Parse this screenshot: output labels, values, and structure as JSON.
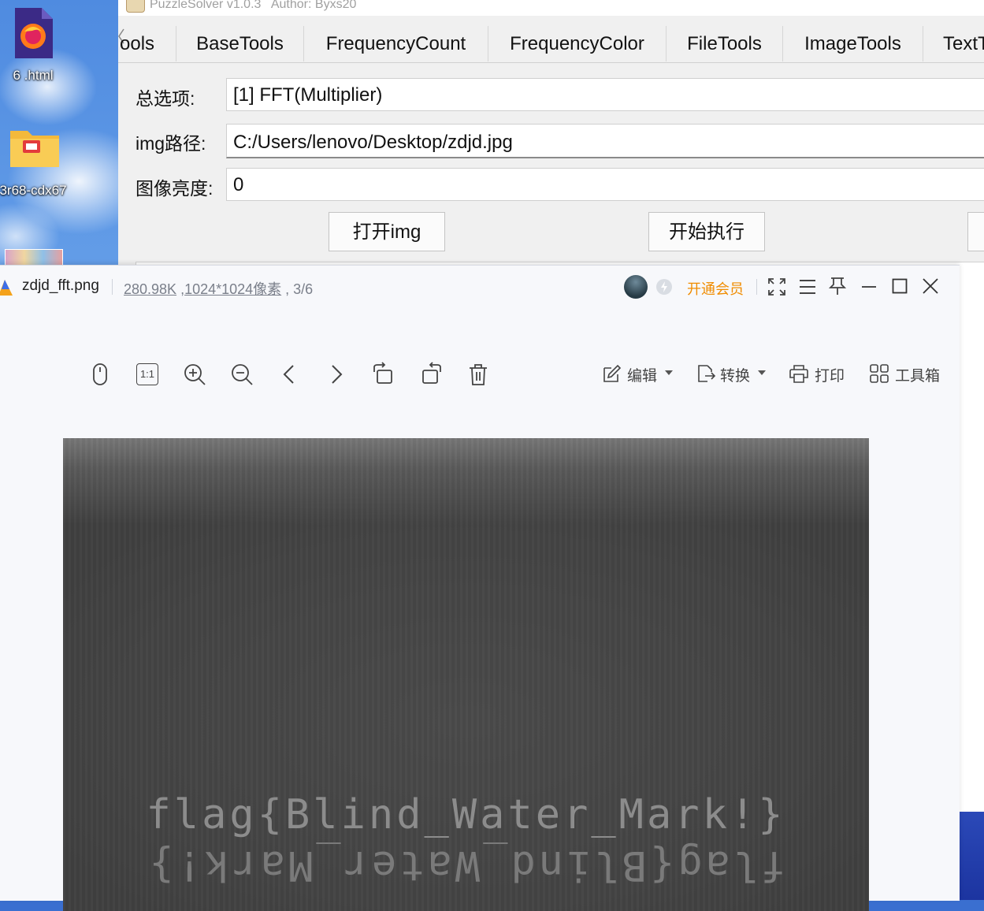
{
  "desktop": {
    "icons": [
      {
        "label": "6 .html",
        "icon": "firefox-html-file-icon"
      },
      {
        "label": "3r68-cdx67",
        "icon": "folder-icon"
      }
    ]
  },
  "puzzle_solver": {
    "title": "PuzzleSolver v1.0.3   Author: Byxs20",
    "tabs": [
      "ools",
      "BaseTools",
      "FrequencyCount",
      "FrequencyColor",
      "FileTools",
      "ImageTools",
      "TextT"
    ],
    "fields": [
      {
        "label": "总选项:",
        "value": "[1] FFT(Multiplier)"
      },
      {
        "label": "img路径:",
        "value": "C:/Users/lenovo/Desktop/zdjd.jpg"
      },
      {
        "label": "图像亮度:",
        "value": "0"
      }
    ],
    "buttons": {
      "open": "打开img",
      "run": "开始执行"
    }
  },
  "viewer": {
    "filename": "zdjd_fft.png",
    "info": {
      "size": "280.98K",
      "separator": " ,",
      "dims": "1024*1024像素",
      "index": " , 3/6"
    },
    "vip_label": "开通会员",
    "accent_color": "#f08c00",
    "toolbar": {
      "icons": [
        "mouse-icon",
        "actual-size-icon",
        "zoom-in-icon",
        "zoom-out-icon",
        "previous-icon",
        "next-icon",
        "rotate-left-icon",
        "rotate-right-icon",
        "delete-icon"
      ],
      "actual_size_label": "1:1",
      "edit": "编辑",
      "convert": "转换",
      "print": "打印",
      "toolbox": "工具箱"
    },
    "image": {
      "watermark_text": "flag{Blind_Water_Mark!}"
    }
  }
}
